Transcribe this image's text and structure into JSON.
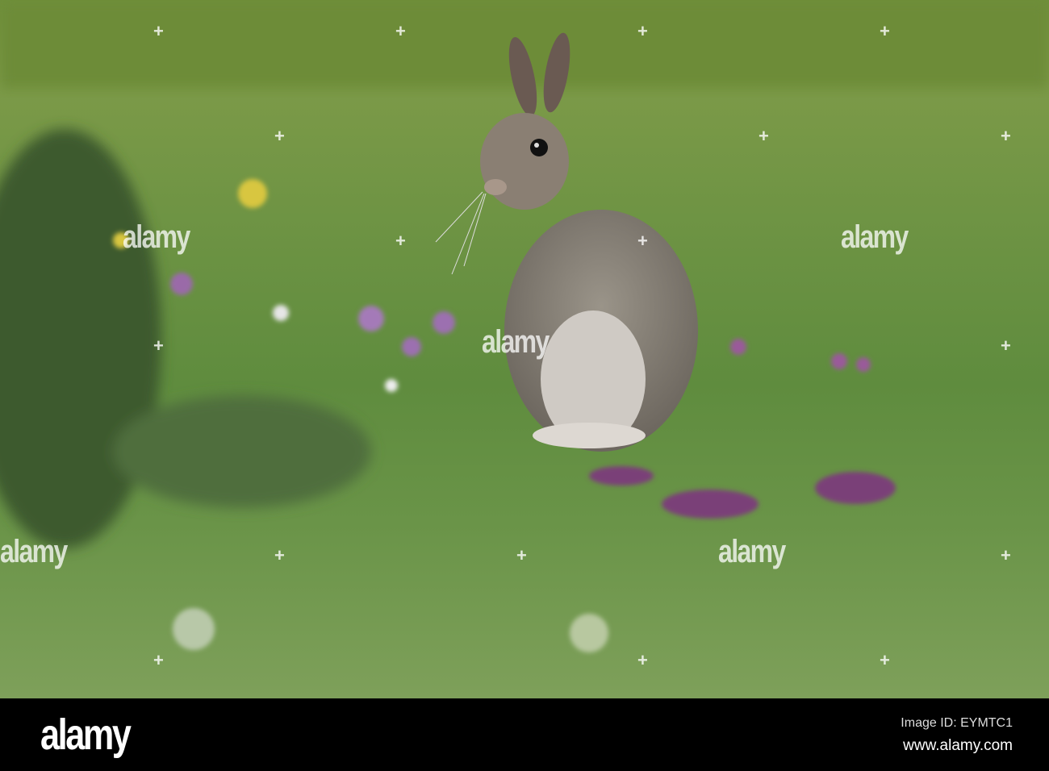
{
  "photo": {
    "subject": "rabbit",
    "watermark": "alamy"
  },
  "footer": {
    "logo": "alamy",
    "image_id": "Image ID: EYMTC1",
    "url": "www.alamy.com"
  }
}
